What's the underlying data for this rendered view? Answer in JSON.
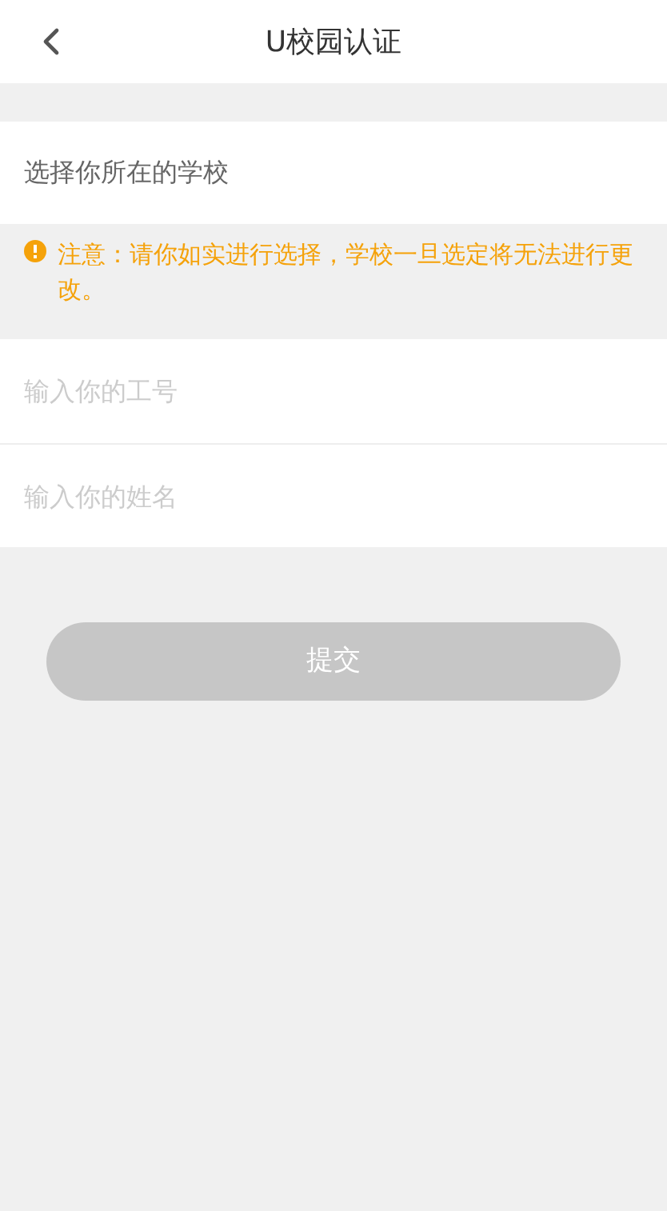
{
  "header": {
    "title": "U校园认证"
  },
  "school_select": {
    "placeholder": "选择你所在的学校"
  },
  "notice": {
    "text": "注意：请你如实进行选择，学校一旦选定将无法进行更改。"
  },
  "fields": [
    {
      "placeholder": "输入你的工号"
    },
    {
      "placeholder": "输入你的姓名"
    }
  ],
  "submit": {
    "label": "提交",
    "disabled": true
  }
}
